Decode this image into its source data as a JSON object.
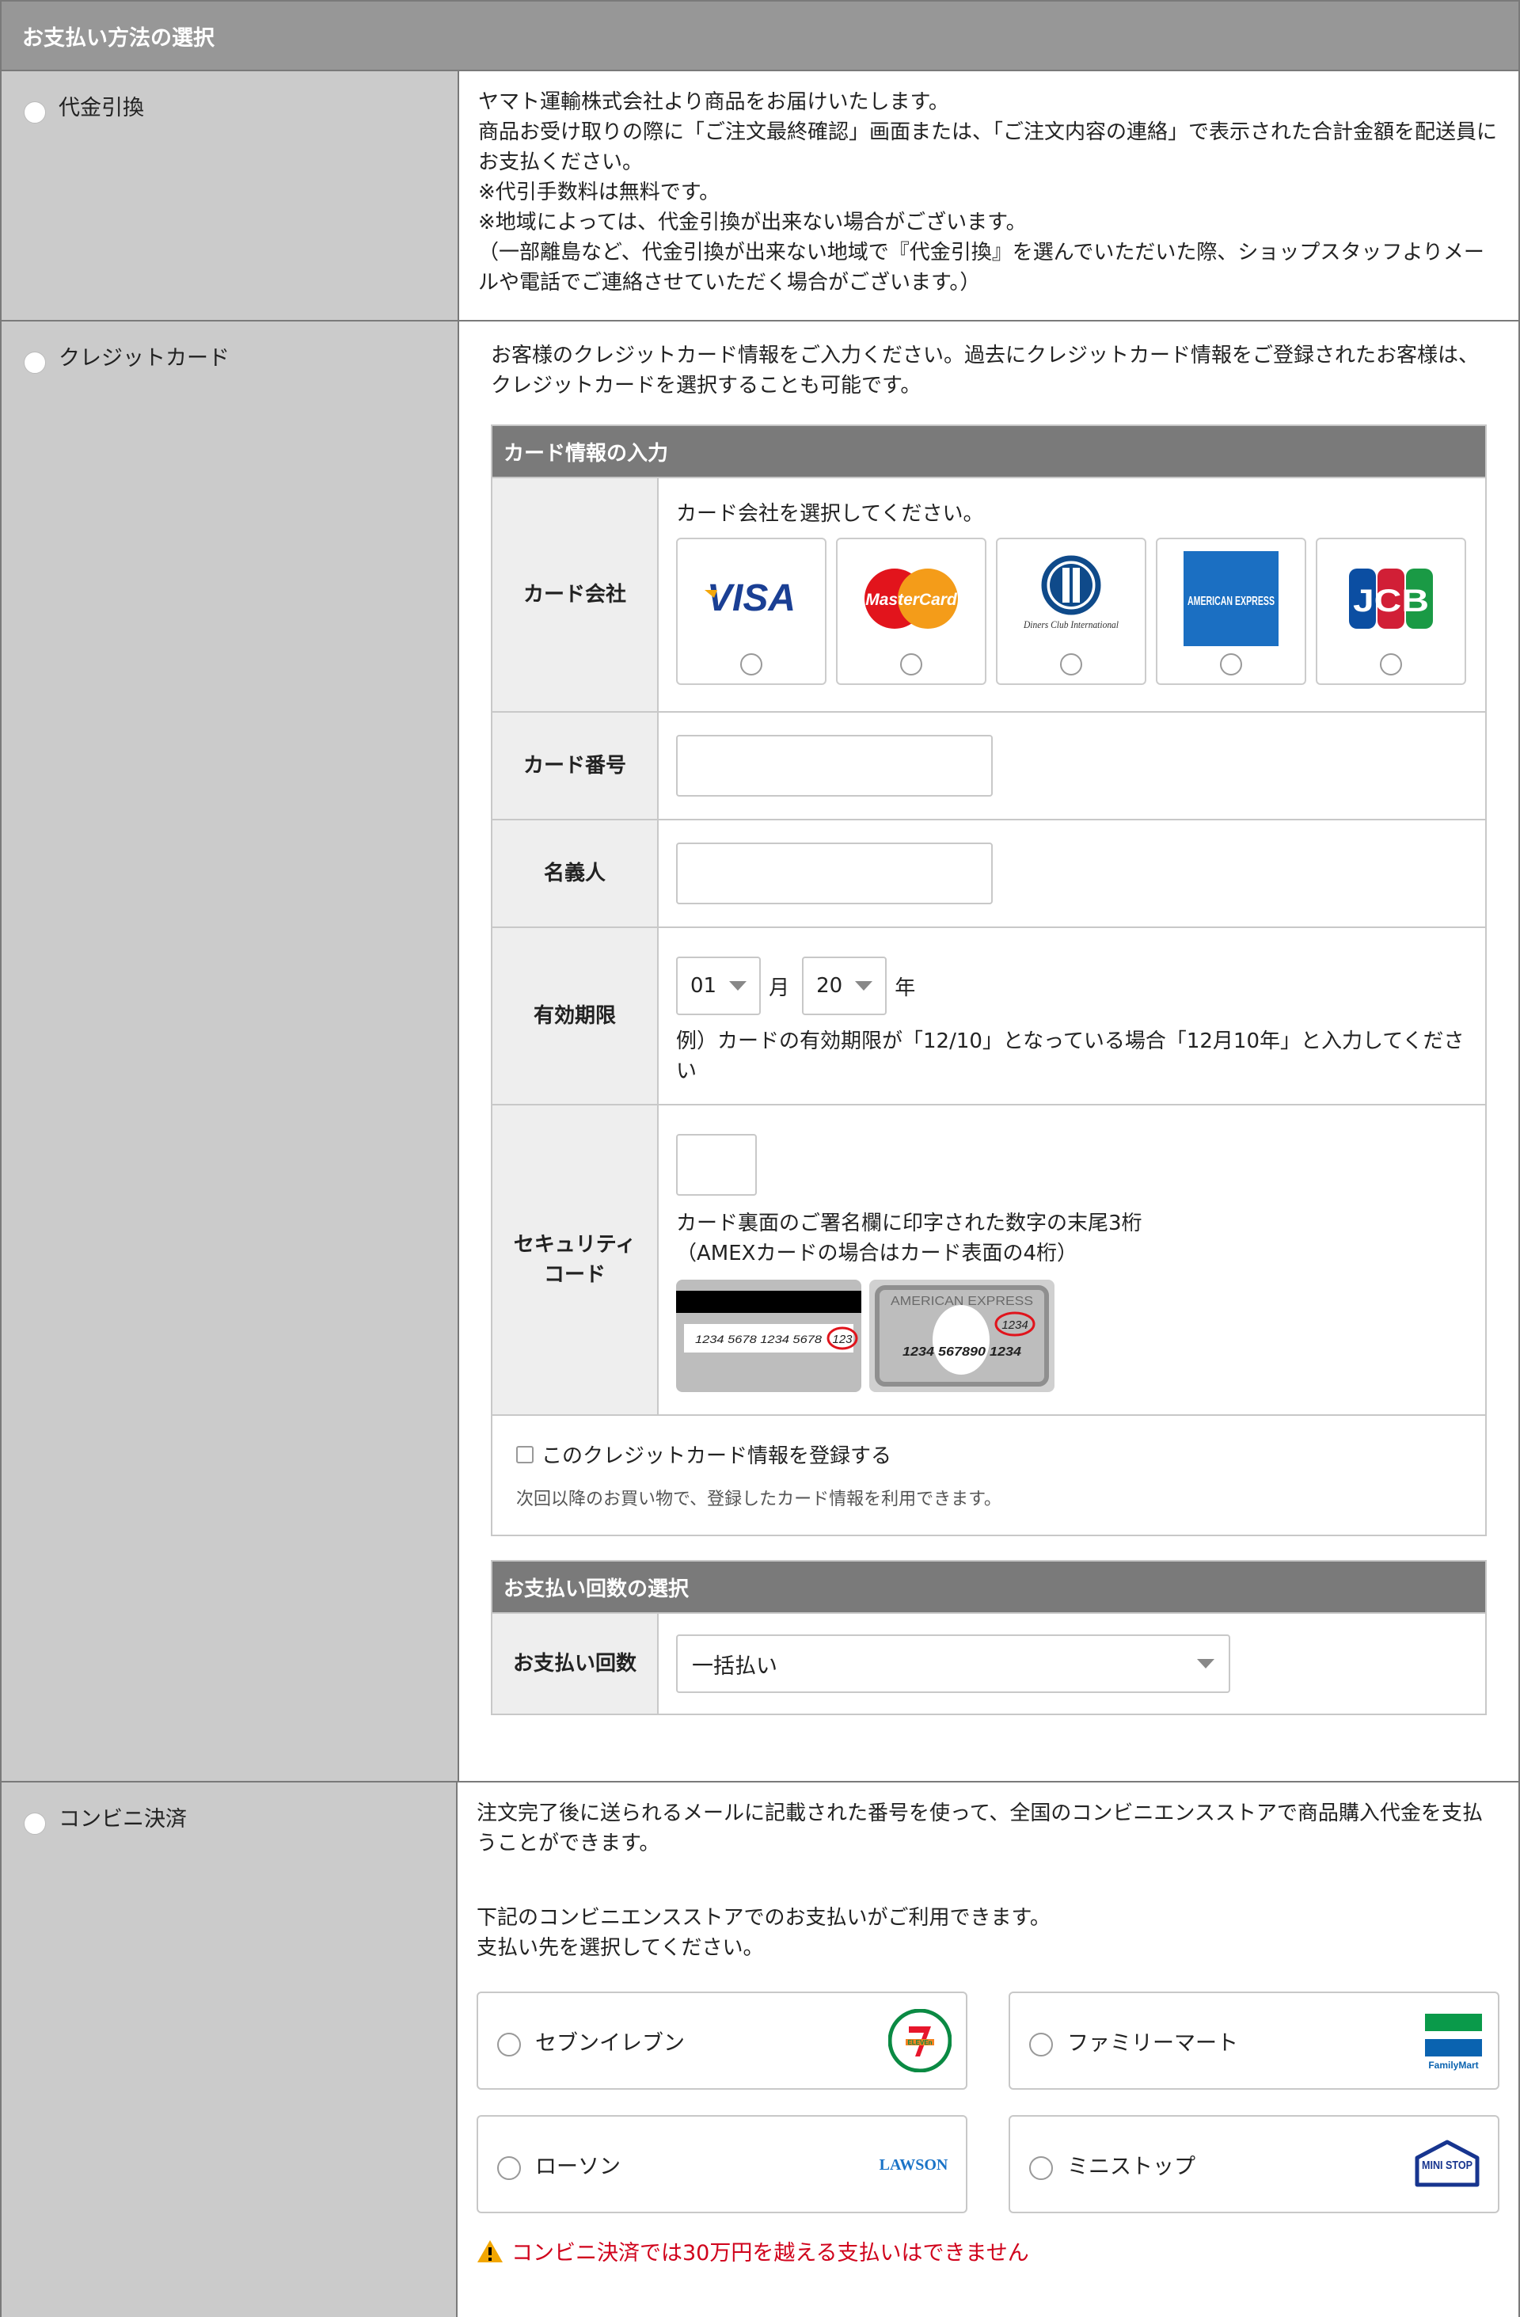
{
  "header": {
    "title": "お支払い方法の選択"
  },
  "cod": {
    "label": "代金引換",
    "lines": [
      "ヤマト運輸株式会社より商品をお届けいたします。",
      "商品お受け取りの際に「ご注文最終確認」画面または、「ご注文内容の連絡」で表示された合計金額を配送員にお支払ください。",
      "※代引手数料は無料です。",
      "※地域によっては、代金引換が出来ない場合がございます。",
      "（一部離島など、代金引換が出来ない地域で『代金引換』を選んでいただいた際、ショップスタッフよりメールや電話でご連絡させていただく場合がございます。）"
    ]
  },
  "credit": {
    "label": "クレジットカード",
    "intro": "お客様のクレジットカード情報をご入力ください。過去にクレジットカード情報をご登録されたお客様は、クレジットカードを選択することも可能です。",
    "card_panel_title": "カード情報の入力",
    "company_label": "カード会社",
    "company_prompt": "カード会社を選択してください。",
    "brands": [
      "VISA",
      "MasterCard",
      "Diners Club International",
      "AMERICAN EXPRESS",
      "JCB"
    ],
    "number_label": "カード番号",
    "holder_label": "名義人",
    "expiry_label": "有効期限",
    "expiry_month": "01",
    "month_unit": "月",
    "expiry_year": "20",
    "year_unit": "年",
    "expiry_note": "例）カードの有効期限が「12/10」となっている場合「12月10年」と入力してください",
    "security_label_1": "セキュリティ",
    "security_label_2": "コード",
    "security_note_1": "カード裏面のご署名欄に印字された数字の末尾3桁",
    "security_note_2": "（AMEXカードの場合はカード表面の4桁）",
    "sample_back_number": "1234 5678 1234 5678",
    "sample_back_code": "123",
    "sample_amex_brand": "AMERICAN EXPRESS",
    "sample_amex_code": "1234",
    "sample_amex_number": "1234 567890 1234",
    "register_label": "このクレジットカード情報を登録する",
    "register_note": "次回以降のお買い物で、登録したカード情報を利用できます。",
    "installment_panel_title": "お支払い回数の選択",
    "installment_label": "お支払い回数",
    "installment_value": "一括払い"
  },
  "convenience": {
    "label": "コンビニ決済",
    "intro": "注文完了後に送られるメールに記載された番号を使って、全国のコンビニエンスストアで商品購入代金を支払うことができます。",
    "select_line_1": "下記のコンビニエンスストアでのお支払いがご利用できます。",
    "select_line_2": "支払い先を選択してください。",
    "stores": [
      "セブンイレブン",
      "ファミリーマート",
      "ローソン",
      "ミニストップ"
    ],
    "store_logo_texts": [
      "ELEVEn",
      "FamilyMart",
      "LAWSON",
      "MINI STOP"
    ],
    "warning": "コンビニ決済では30万円を越える支払いはできません"
  }
}
